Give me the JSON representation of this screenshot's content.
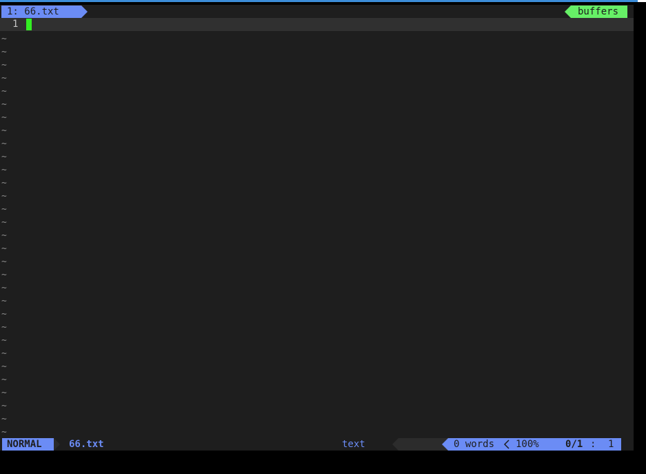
{
  "tabline": {
    "buffer_tab": "1: 66.txt",
    "buffers_label": "buffers"
  },
  "editor": {
    "line_number": "1",
    "empty_line_marker": "~",
    "empty_line_count": 31
  },
  "statusline": {
    "mode": "NORMAL",
    "filename": "66.txt",
    "filetype": "text",
    "word_count": "0 words",
    "percent": "100%",
    "position": "0/1",
    "position_sep": ":",
    "column": "1"
  },
  "colors": {
    "background": "#1e1e1e",
    "accent_blue": "#6b8cf5",
    "accent_green": "#66f066",
    "cursor": "#33ee22",
    "cursor_line": "#303030"
  }
}
